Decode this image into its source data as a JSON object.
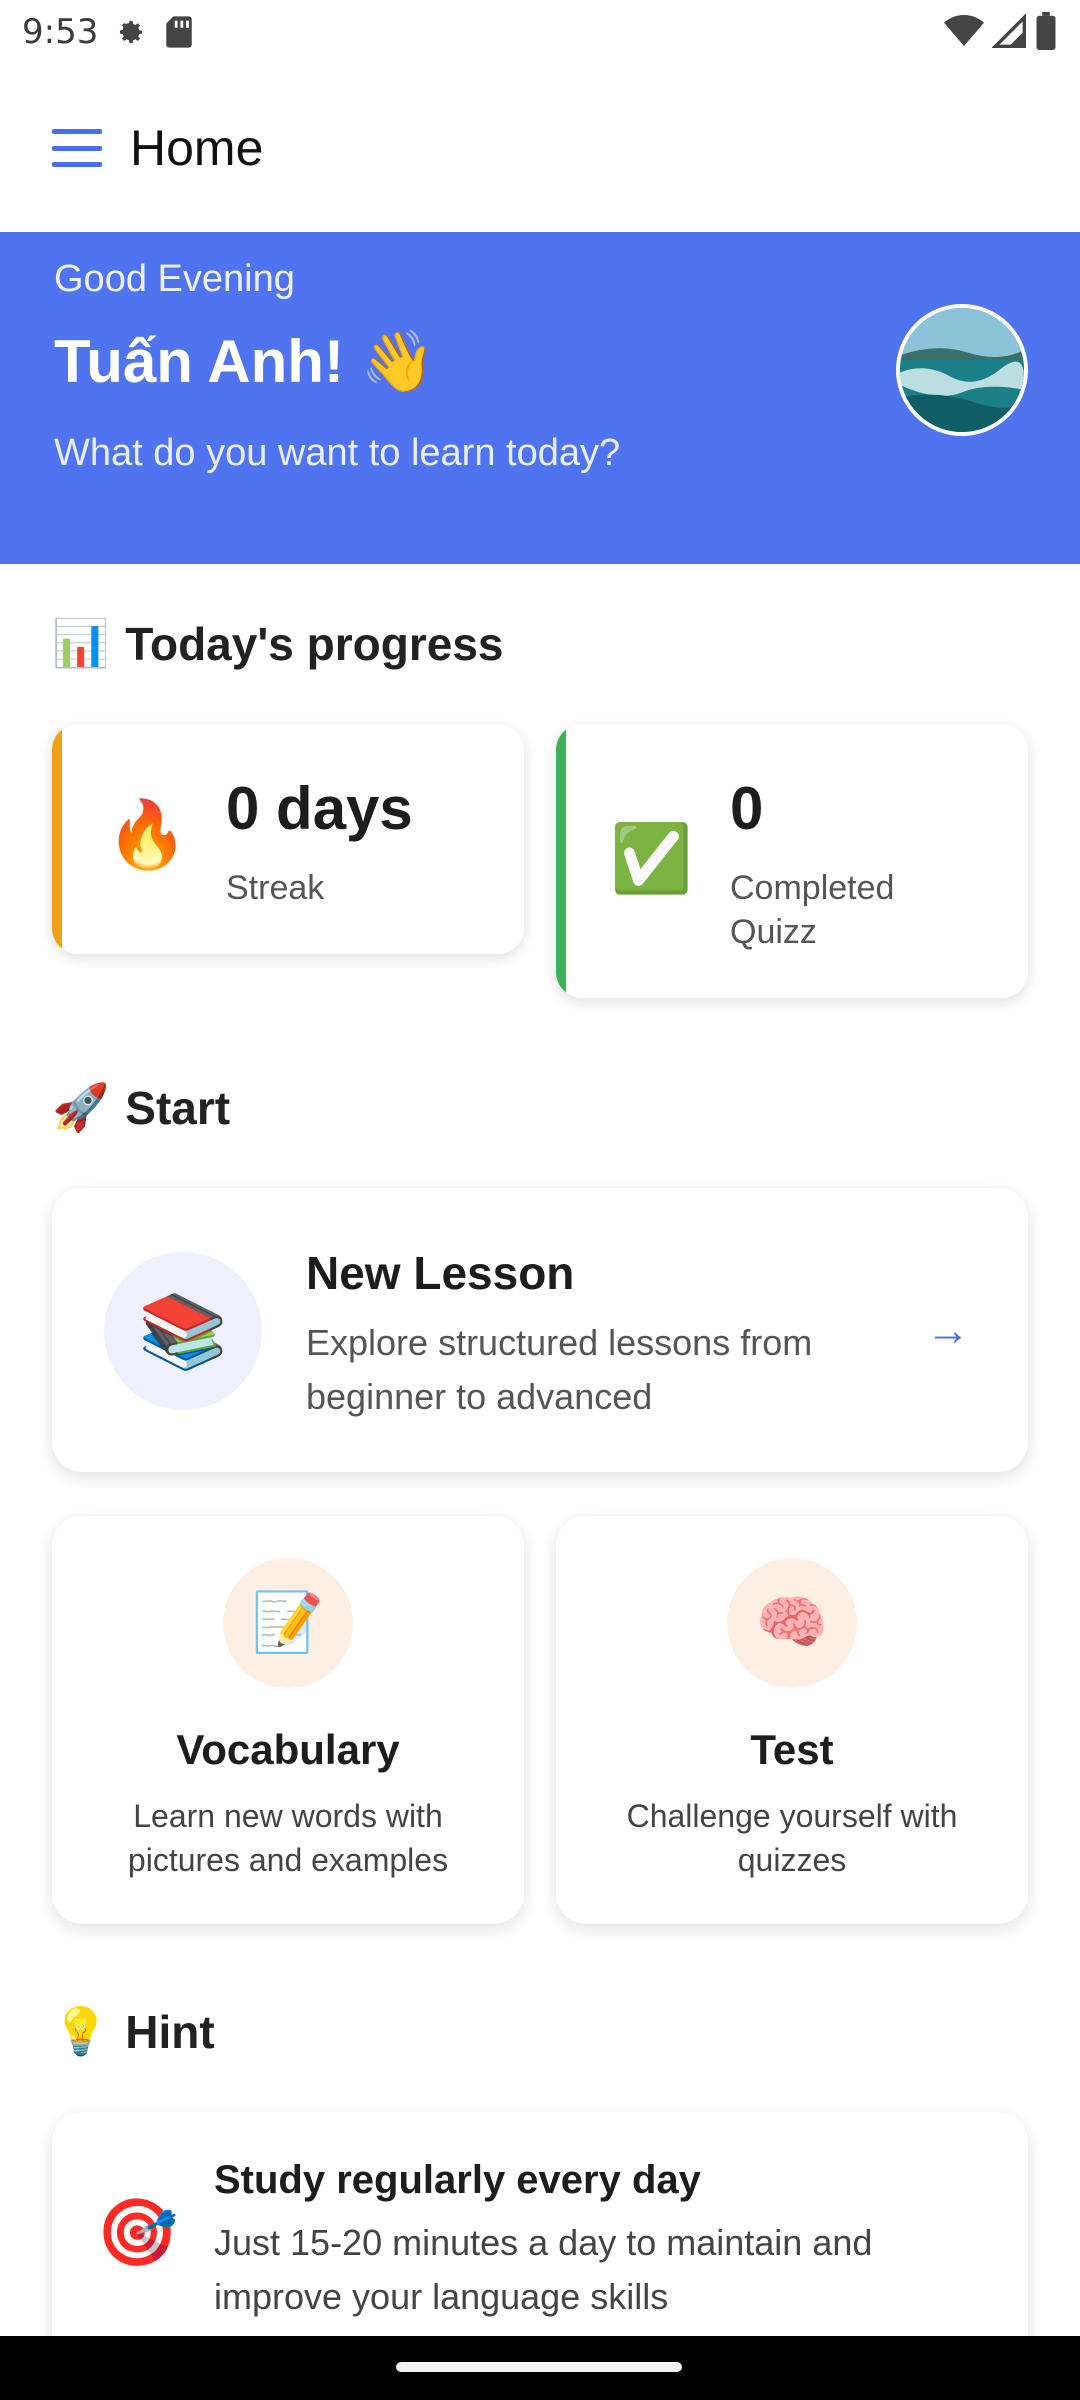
{
  "status_bar": {
    "time": "9:53",
    "icons_left": [
      "settings-icon",
      "sd-card-icon"
    ],
    "icons_right": [
      "wifi-icon",
      "signal-icon",
      "battery-icon"
    ]
  },
  "app_bar": {
    "title": "Home",
    "menu_icon": "menu-icon"
  },
  "hero": {
    "greeting": "Good Evening",
    "name": "Tuấn Anh! 👋",
    "subtitle": "What do you want to learn today?",
    "background_color": "#5074ef"
  },
  "progress": {
    "title": "Today's progress",
    "title_emoji": "📊",
    "cards": [
      {
        "emoji": "🔥",
        "value": "0 days",
        "label": "Streak",
        "accent_color": "#f2a116"
      },
      {
        "emoji": "✅",
        "value": "0",
        "label": "Completed Quizz",
        "accent_color": "#3db25a"
      }
    ]
  },
  "start": {
    "title": "Start",
    "title_emoji": "🚀",
    "new_lesson": {
      "emoji": "📚",
      "title": "New Lesson",
      "description": "Explore structured lessons from beginner to advanced",
      "arrow": "→"
    },
    "features": [
      {
        "emoji": "📝",
        "title": "Vocabulary",
        "description": "Learn new words with pictures and examples"
      },
      {
        "emoji": "🧠",
        "title": "Test",
        "description": "Challenge yourself with quizzes"
      }
    ]
  },
  "hint": {
    "title": "Hint",
    "title_emoji": "💡",
    "card": {
      "emoji": "🎯",
      "title": "Study regularly every day",
      "description": "Just 15-20 minutes a day to maintain and improve your language skills"
    }
  }
}
